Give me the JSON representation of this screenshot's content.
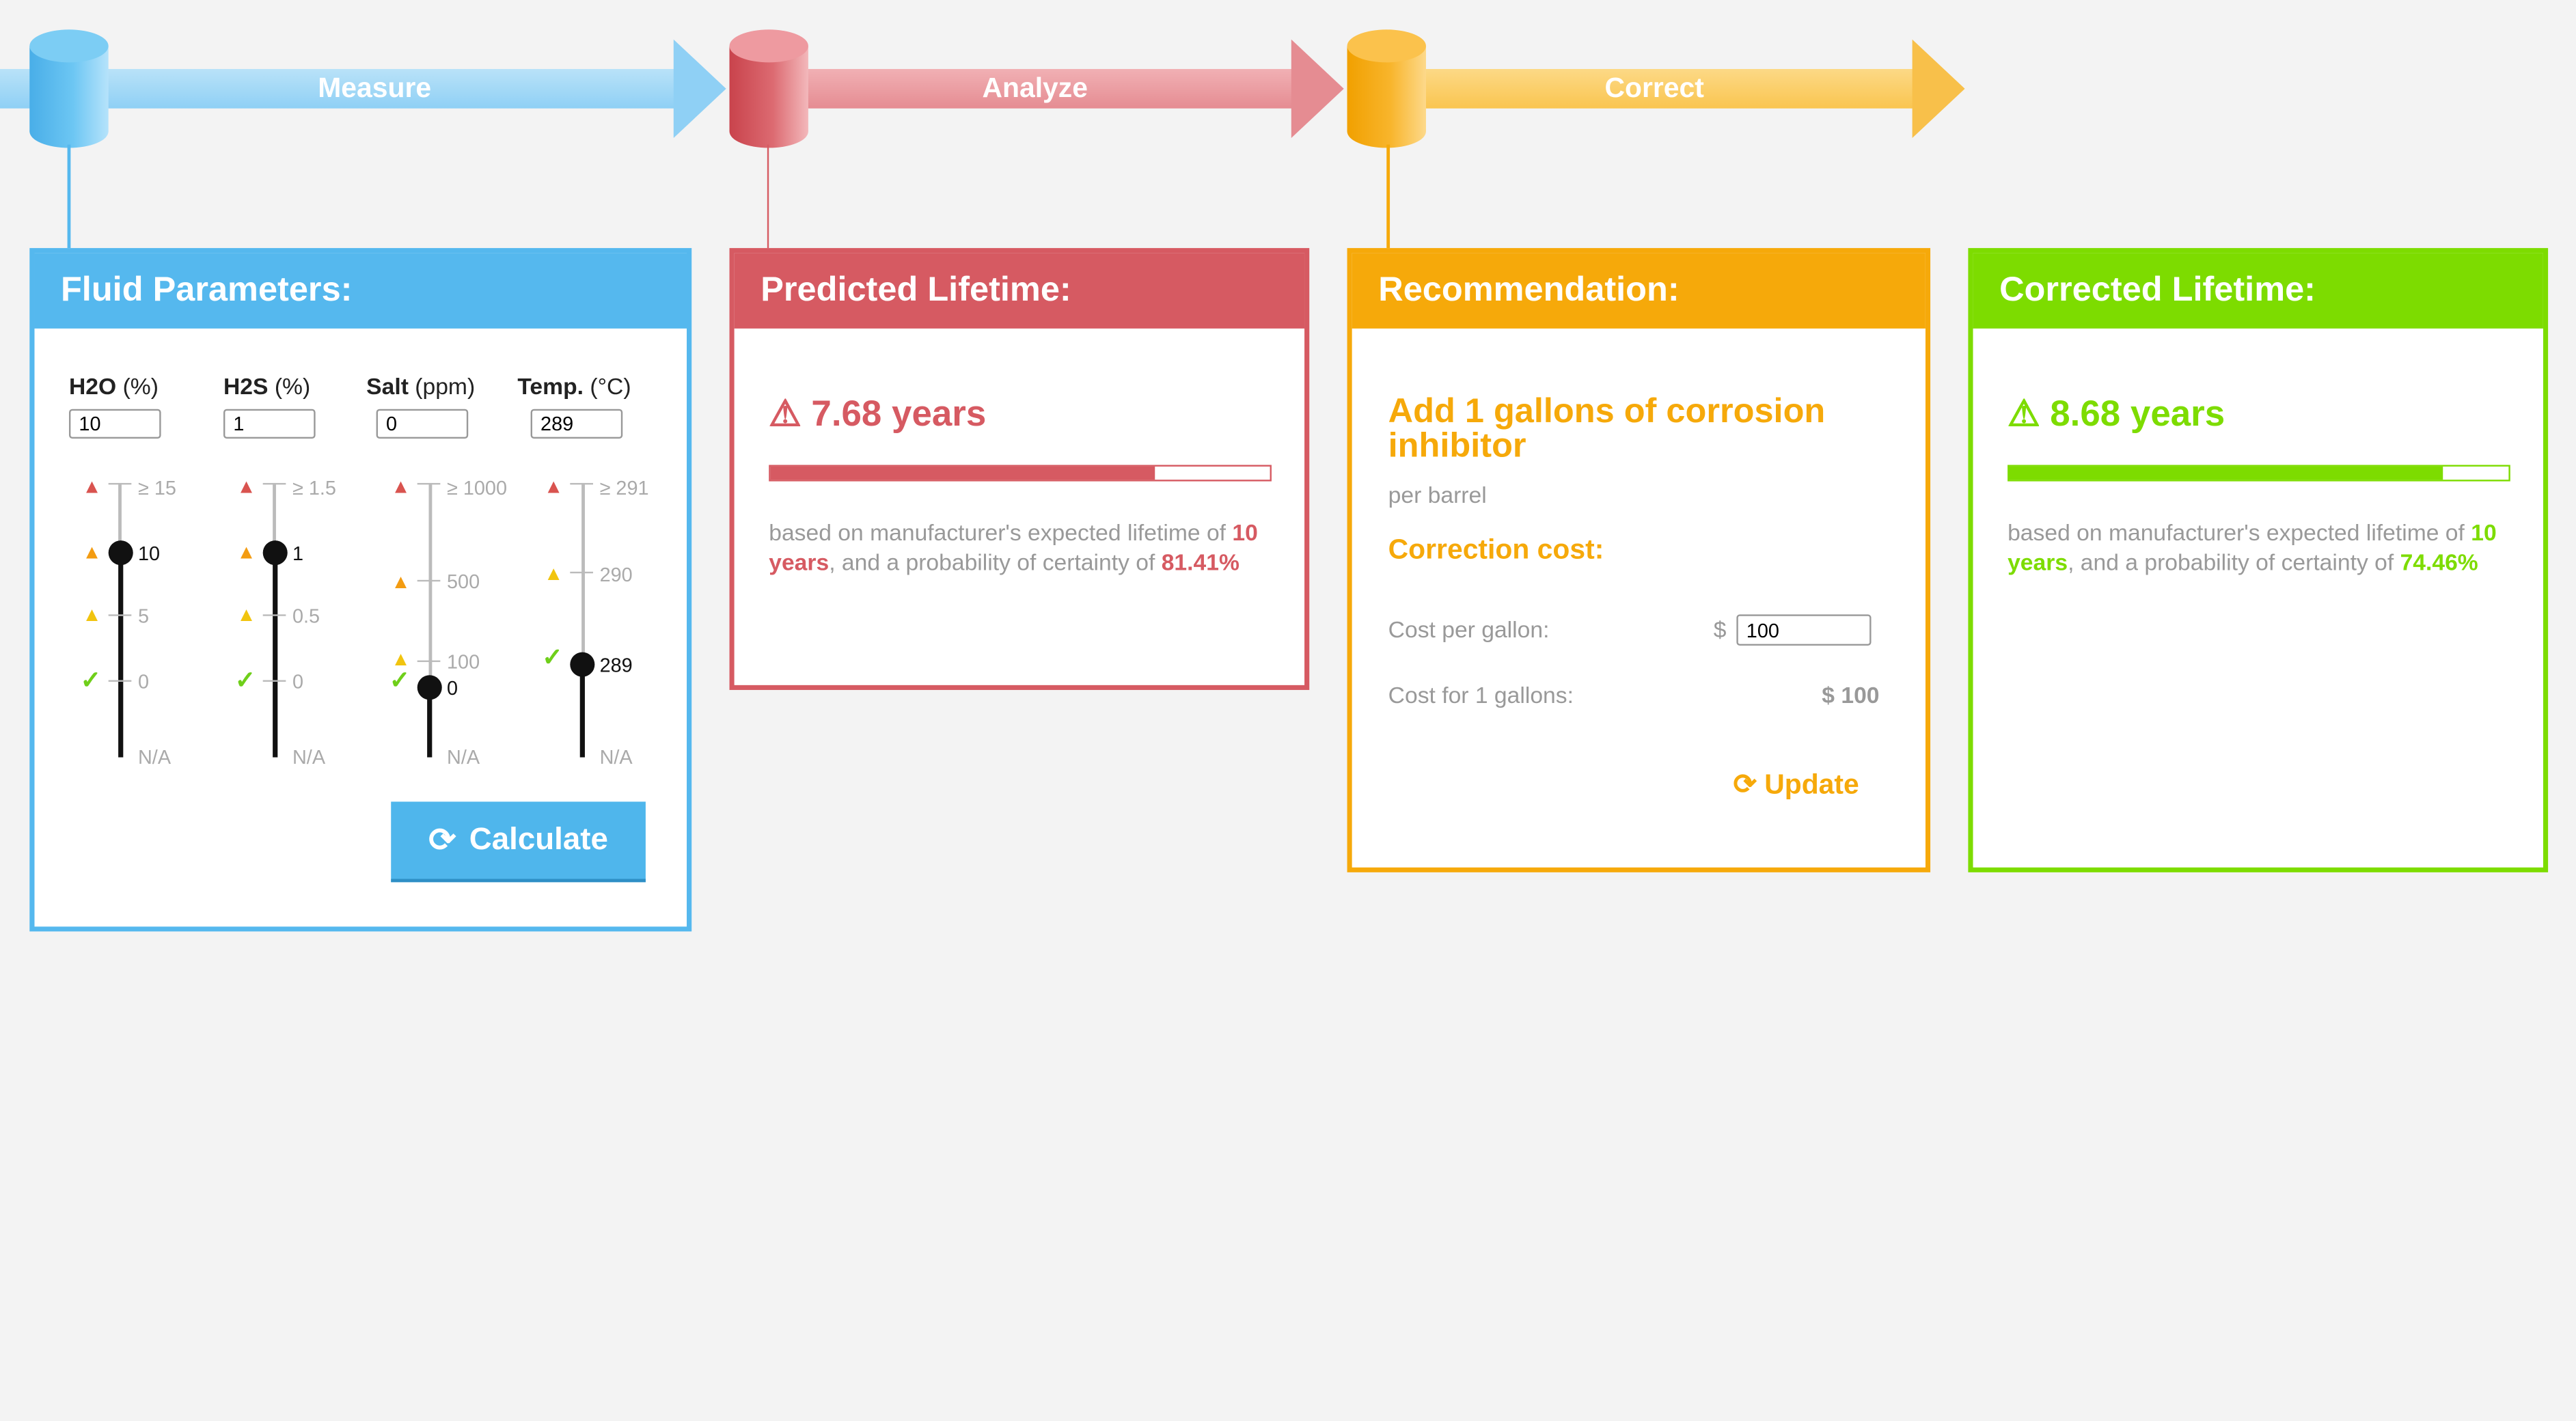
{
  "colors": {
    "measure": "#55b8ee",
    "analyze": "#d65a62",
    "correct": "#f6a90a",
    "corrected": "#7ddc00",
    "warn_red": "#d9534f",
    "warn_orange": "#f39c12",
    "warn_yellow": "#f1c40f",
    "ok_green": "#6fcf1a"
  },
  "pipeline": {
    "steps": [
      {
        "label": "Measure",
        "icon": "cylinder-icon"
      },
      {
        "label": "Analyze",
        "icon": "cylinder-icon"
      },
      {
        "label": "Correct",
        "icon": "cylinder-icon"
      }
    ]
  },
  "fluid": {
    "title": "Fluid Parameters:",
    "params": [
      {
        "name": "H2O",
        "unit": "(%)",
        "value": "10",
        "ticks": [
          "≥ 15",
          "10",
          "5",
          "0"
        ],
        "na": "N/A",
        "current": "10"
      },
      {
        "name": "H2S",
        "unit": "(%)",
        "value": "1",
        "ticks": [
          "≥ 1.5",
          "1",
          "0.5",
          "0"
        ],
        "na": "N/A",
        "current": "1"
      },
      {
        "name": "Salt",
        "unit": "(ppm)",
        "value": "0",
        "ticks": [
          "≥ 1000",
          "500",
          "100",
          "0"
        ],
        "na": "N/A",
        "current": "0"
      },
      {
        "name": "Temp.",
        "unit": "(°C)",
        "value": "289",
        "ticks": [
          "≥ 291",
          "290",
          "289"
        ],
        "na": "N/A",
        "current": "289"
      }
    ],
    "calculate_label": "Calculate"
  },
  "predicted": {
    "title": "Predicted Lifetime:",
    "value": "7.68 years",
    "progress": 0.77,
    "note_prefix": "based on manufacturer's expected lifetime of",
    "expected": "10 years",
    "note_mid": ", and a probability of certainty of",
    "certainty": "81.41%"
  },
  "recommendation": {
    "title": "Recommendation:",
    "headline": "Add 1 gallons of corrosion inhibitor",
    "sub": "per barrel",
    "cost_heading": "Correction cost:",
    "cost_per_gallon_label": "Cost per gallon:",
    "currency": "$",
    "cost_per_gallon_value": "100",
    "cost_for_label": "Cost for 1 gallons:",
    "cost_for_value": "$ 100",
    "update_label": "Update"
  },
  "corrected": {
    "title": "Corrected Lifetime:",
    "value": "8.68 years",
    "progress": 0.87,
    "note_prefix": "based on manufacturer's expected lifetime of",
    "expected": "10 years",
    "note_mid": ", and a probability of certainty of",
    "certainty": "74.46%"
  }
}
